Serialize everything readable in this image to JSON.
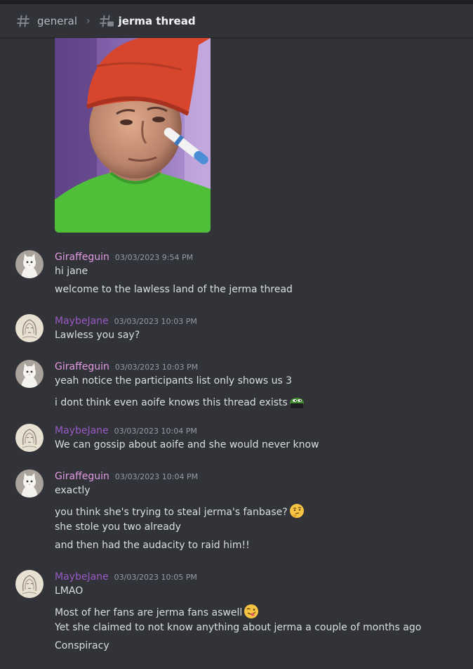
{
  "header": {
    "parent_channel": "general",
    "thread_name": "jerma thread"
  },
  "colors": {
    "giraffeguin": "#e39be4",
    "maybejane": "#9b59c6",
    "background": "#313338"
  },
  "messages": [
    {
      "author": "Giraffeguin",
      "timestamp": "03/03/2023 9:54 PM",
      "avatar": "white-cat-avatar",
      "lines": [
        "hi jane",
        "welcome to the lawless land of the jerma thread"
      ]
    },
    {
      "author": "MaybeJane",
      "timestamp": "03/03/2023 10:03 PM",
      "avatar": "sketch-avatar",
      "lines": [
        "Lawless you say?"
      ]
    },
    {
      "author": "Giraffeguin",
      "timestamp": "03/03/2023 10:03 PM",
      "avatar": "white-cat-avatar",
      "lines": [
        "yeah notice the participants list only shows us 3",
        "i dont think even aoife knows this thread exists"
      ]
    },
    {
      "author": "MaybeJane",
      "timestamp": "03/03/2023 10:04 PM",
      "avatar": "sketch-avatar",
      "lines": [
        "We can gossip about aoife and she would never know"
      ]
    },
    {
      "author": "Giraffeguin",
      "timestamp": "03/03/2023 10:04 PM",
      "avatar": "white-cat-avatar",
      "lines": [
        "exactly",
        "you think she's trying to steal jerma's fanbase?",
        "she stole you two already",
        "and then had the audacity to raid him!!"
      ]
    },
    {
      "author": "MaybeJane",
      "timestamp": "03/03/2023 10:05 PM",
      "avatar": "sketch-avatar",
      "lines": [
        "LMAO",
        "Most of her fans are jerma fans aswell",
        "Yet she claimed to not know anything about jerma a couple of months ago",
        "Conspiracy"
      ]
    }
  ]
}
